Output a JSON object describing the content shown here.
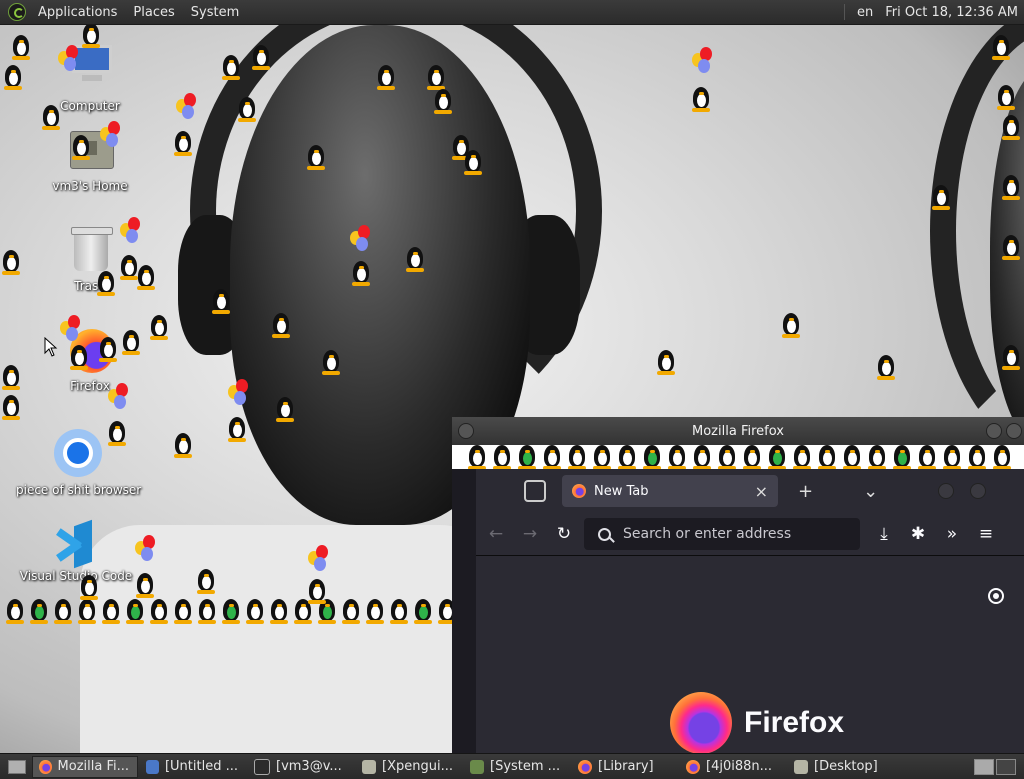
{
  "top_panel": {
    "menus": [
      "Applications",
      "Places",
      "System"
    ],
    "keyboard_layout": "en",
    "clock": "Fri Oct 18, 12:36 AM"
  },
  "desktop": {
    "icons": [
      {
        "label": "Computer",
        "icon": "computer-icon"
      },
      {
        "label": "vm3's Home",
        "icon": "home-folder-icon"
      },
      {
        "label": "Trash",
        "icon": "trash-icon"
      },
      {
        "label": "Firefox",
        "icon": "firefox-icon"
      },
      {
        "label": "piece of shit browser",
        "icon": "chromium-icon"
      },
      {
        "label": "Visual Studio Code",
        "icon": "vscode-icon"
      }
    ]
  },
  "firefox_window": {
    "title": "Mozilla Firefox",
    "tab": {
      "label": "New Tab",
      "close": "×"
    },
    "new_tab": "+",
    "tab_list": "⌄",
    "nav": {
      "back": "←",
      "forward": "→",
      "reload": "↻",
      "overflow": "»",
      "menu": "≡",
      "download": "⤓",
      "extensions": "✱"
    },
    "urlbar_placeholder": "Search or enter address",
    "brand": "Firefox"
  },
  "taskbar": {
    "tasks": [
      {
        "label": "Mozilla Fi...",
        "icon": "firefox-icon",
        "active": true
      },
      {
        "label": "[Untitled ...",
        "icon": "editor-icon",
        "active": false
      },
      {
        "label": "[vm3@v...",
        "icon": "terminal-icon",
        "active": false
      },
      {
        "label": "[Xpengui...",
        "icon": "window-icon",
        "active": false
      },
      {
        "label": "[System ...",
        "icon": "system-monitor-icon",
        "active": false
      },
      {
        "label": "[Library]",
        "icon": "firefox-icon",
        "active": false
      },
      {
        "label": "[4j0i88n...",
        "icon": "firefox-icon",
        "active": false
      },
      {
        "label": "[Desktop]",
        "icon": "folder-icon",
        "active": false
      }
    ]
  },
  "colors": {
    "panel": "#2f2f2f",
    "firefox_bg": "#2b2a33",
    "firefox_accent": "#ff7139"
  }
}
